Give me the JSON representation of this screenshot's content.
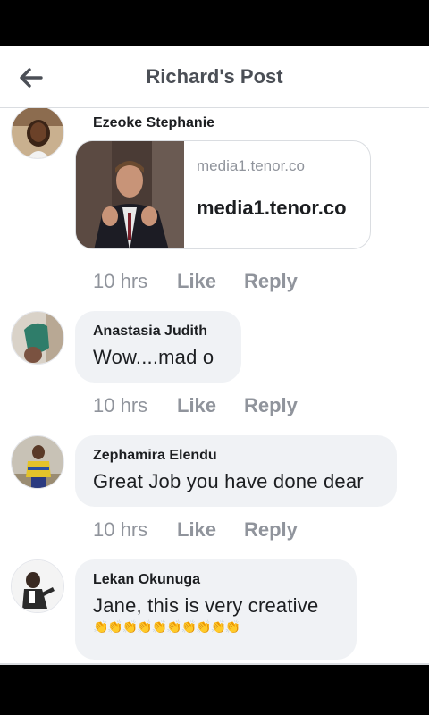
{
  "header": {
    "title": "Richard's Post"
  },
  "comments": [
    {
      "author": "Ezeoke Stephanie",
      "link": {
        "domain_small": "media1.tenor.co",
        "domain_big": "media1.tenor.co"
      },
      "time": "10 hrs",
      "like": "Like",
      "reply": "Reply"
    },
    {
      "author": "Anastasia Judith",
      "text": "Wow....mad o",
      "time": "10 hrs",
      "like": "Like",
      "reply": "Reply"
    },
    {
      "author": "Zephamira Elendu",
      "text": "Great Job you have done dear",
      "time": "10 hrs",
      "like": "Like",
      "reply": "Reply"
    },
    {
      "author": "Lekan Okunuga",
      "text": "Jane, this is very creative",
      "emoji": "👏👏👏👏👏👏👏👏👏👏"
    }
  ],
  "icons": {
    "back": "back-arrow-icon",
    "clap": "clapping-hands-emoji"
  },
  "colors": {
    "bubble": "#f0f2f5",
    "muted": "#90949c",
    "title": "#4b4f56"
  }
}
